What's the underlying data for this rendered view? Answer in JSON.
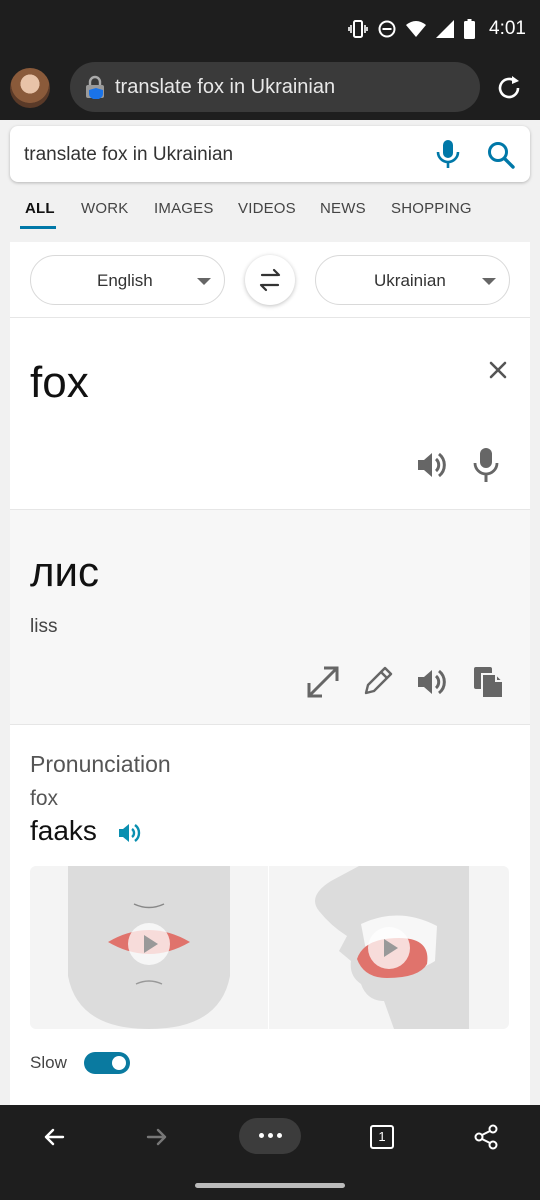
{
  "status_bar": {
    "time": "4:01",
    "icons": [
      "vibrate-icon",
      "do-not-disturb-icon",
      "wifi-icon",
      "signal-icon",
      "battery-icon"
    ]
  },
  "browser": {
    "url_text": "translate fox in Ukrainian",
    "icons": [
      "avatar",
      "lock-icon",
      "reload-icon"
    ]
  },
  "search": {
    "query": "translate fox in Ukrainian",
    "icons": [
      "mic-icon",
      "search-icon"
    ]
  },
  "tabs": [
    {
      "label": "ALL",
      "active": true
    },
    {
      "label": "WORK"
    },
    {
      "label": "IMAGES"
    },
    {
      "label": "VIDEOS"
    },
    {
      "label": "NEWS"
    },
    {
      "label": "SHOPPING"
    }
  ],
  "translator": {
    "source_lang": "English",
    "target_lang": "Ukrainian",
    "source_text": "fox",
    "target_text": "лис",
    "transliteration": "liss",
    "icons": [
      "swap-icon",
      "close-icon",
      "speaker-icon",
      "mic-icon",
      "expand-icon",
      "pencil-icon",
      "copy-icon"
    ]
  },
  "pronunciation": {
    "heading": "Pronunciation",
    "word": "fox",
    "phonetic": "faaks",
    "slow_label": "Slow",
    "slow_enabled": true
  },
  "bottom_nav": {
    "tab_count": "1",
    "icons": [
      "back-arrow-icon",
      "forward-arrow-icon",
      "more-dots-icon",
      "tabs-icon",
      "share-icon"
    ]
  },
  "colors": {
    "accent": "#0078a8",
    "dark_bar": "#1e1e1e",
    "toggle": "#0a7aa0",
    "lip": "#e0736c"
  }
}
